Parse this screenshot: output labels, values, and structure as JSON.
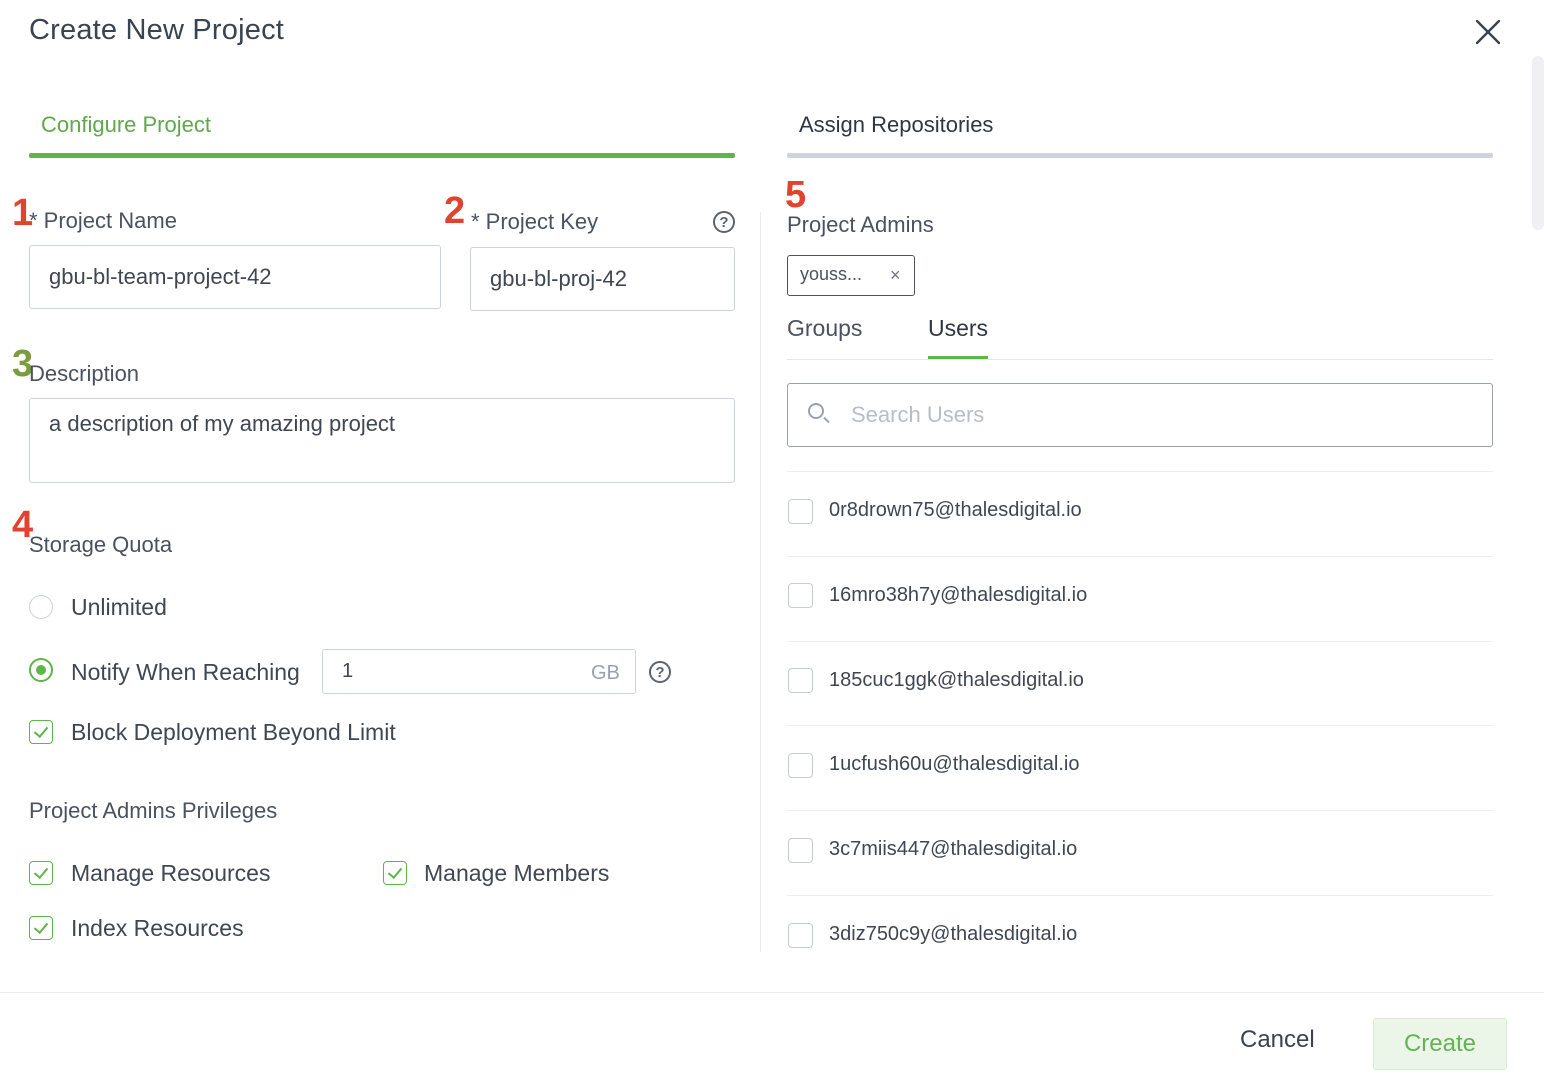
{
  "dialog": {
    "title": "Create New Project"
  },
  "steps": [
    {
      "label": "Configure Project",
      "active": true
    },
    {
      "label": "Assign Repositories",
      "active": false
    }
  ],
  "annotations": [
    "1",
    "2",
    "3",
    "4",
    "5"
  ],
  "colors": {
    "accent": "#5eb64a",
    "annotation_red": "#e0432f",
    "annotation_green": "#7a9d3e"
  },
  "form": {
    "project_name": {
      "label": "* Project Name",
      "value": "gbu-bl-team-project-42"
    },
    "project_key": {
      "label": "* Project Key",
      "value": "gbu-bl-proj-42",
      "help": "?"
    },
    "description": {
      "label": "Description",
      "value": "a description of my amazing project"
    },
    "storage_quota": {
      "label": "Storage Quota",
      "options": [
        {
          "label": "Unlimited",
          "selected": false
        },
        {
          "label": "Notify When Reaching",
          "selected": true
        }
      ],
      "limit_value": "1",
      "limit_unit": "GB",
      "help": "?",
      "block_label": "Block Deployment Beyond Limit",
      "block_checked": true
    },
    "privileges": {
      "label": "Project Admins Privileges",
      "items": [
        {
          "label": "Manage Resources",
          "checked": true
        },
        {
          "label": "Manage Members",
          "checked": true
        },
        {
          "label": "Index Resources",
          "checked": true
        }
      ]
    }
  },
  "admins": {
    "label": "Project Admins",
    "chip": "youss...",
    "chip_remove": "×",
    "tabs": [
      {
        "label": "Groups",
        "active": false
      },
      {
        "label": "Users",
        "active": true
      }
    ],
    "search_placeholder": "Search Users",
    "users": [
      "0r8drown75@thalesdigital.io",
      "16mro38h7y@thalesdigital.io",
      "185cuc1ggk@thalesdigital.io",
      "1ucfush60u@thalesdigital.io",
      "3c7miis447@thalesdigital.io",
      "3diz750c9y@thalesdigital.io"
    ]
  },
  "footer": {
    "cancel": "Cancel",
    "create": "Create"
  }
}
